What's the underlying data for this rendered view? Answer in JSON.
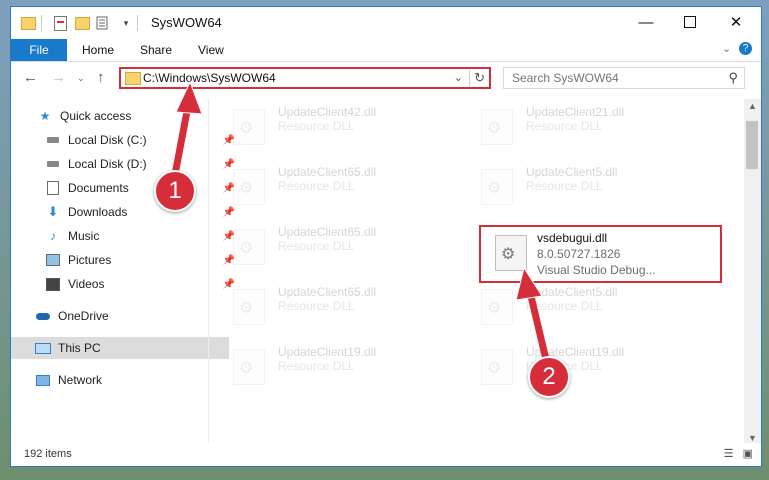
{
  "window": {
    "title": "SysWOW64",
    "minimize_icon": "minimize-icon",
    "maximize_icon": "maximize-icon",
    "close_icon": "close-icon"
  },
  "ribbon": {
    "tabs": [
      {
        "label": "File"
      },
      {
        "label": "Home"
      },
      {
        "label": "Share"
      },
      {
        "label": "View"
      }
    ]
  },
  "nav": {
    "address": "C:\\Windows\\SysWOW64",
    "search_placeholder": "Search SysWOW64"
  },
  "sidebar": {
    "items": [
      {
        "label": "Quick access",
        "icon": "star-icon"
      },
      {
        "label": "Local Disk (C:)",
        "icon": "drive-icon"
      },
      {
        "label": "Local Disk (D:)",
        "icon": "drive-icon"
      },
      {
        "label": "Documents",
        "icon": "documents-icon"
      },
      {
        "label": "Downloads",
        "icon": "download-icon"
      },
      {
        "label": "Music",
        "icon": "music-icon"
      },
      {
        "label": "Pictures",
        "icon": "pictures-icon"
      },
      {
        "label": "Videos",
        "icon": "videos-icon"
      },
      {
        "label": "OneDrive",
        "icon": "cloud-icon"
      },
      {
        "label": "This PC",
        "icon": "pc-icon"
      },
      {
        "label": "Network",
        "icon": "network-icon"
      }
    ]
  },
  "files": [
    {
      "name": "UpdateClient42.dll",
      "desc": "Resource DLL"
    },
    {
      "name": "UpdateClient21.dll",
      "desc": "Resource DLL"
    },
    {
      "name": "UpdateClient65.dll",
      "desc": "Resource DLL"
    },
    {
      "name": "UpdateClient5.dll",
      "desc": "Resource DLL"
    },
    {
      "name": "UpdateClient65.dll",
      "desc": "Resource DLL"
    },
    {
      "name": "vsdebugui.dll",
      "version": "8.0.50727.1826",
      "desc": "Visual Studio Debug..."
    },
    {
      "name": "UpdateClient65.dll",
      "desc": "Resource DLL"
    },
    {
      "name": "UpdateClient5.dll",
      "desc": "Resource DLL"
    },
    {
      "name": "UpdateClient19.dll",
      "desc": "Resource DLL"
    },
    {
      "name": "UpdateClient19.dll",
      "desc": "Resource DLL"
    }
  ],
  "status": {
    "item_count": "192 items"
  },
  "annotations": {
    "step1": "1",
    "step2": "2"
  },
  "colors": {
    "accent": "#1979ca",
    "highlight": "#d62d3b"
  }
}
